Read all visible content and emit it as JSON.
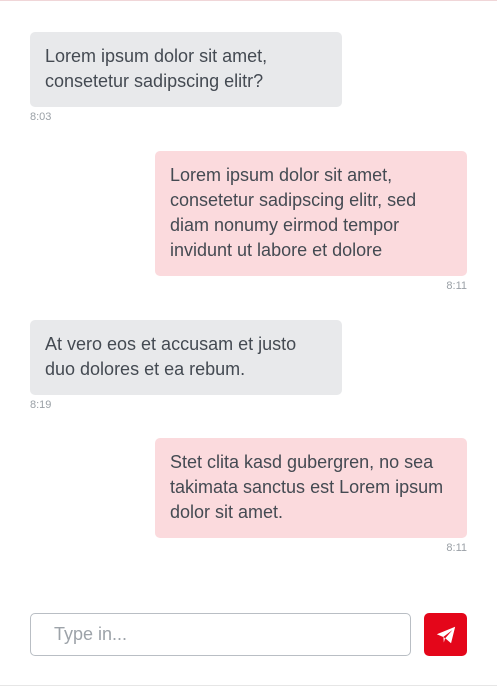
{
  "messages": [
    {
      "direction": "received",
      "text": "Lorem ipsum dolor sit amet, consetetur sadipscing elitr?",
      "time": "8:03"
    },
    {
      "direction": "sent",
      "text": "Lorem ipsum dolor sit amet, consetetur sadipscing elitr, sed diam nonumy eirmod tempor invidunt ut labore et dolore",
      "time": "8:11"
    },
    {
      "direction": "received",
      "text": "At vero eos et accusam et justo duo dolores et ea rebum.",
      "time": "8:19"
    },
    {
      "direction": "sent",
      "text": "Stet clita kasd gubergren, no sea takimata sanctus est Lorem ipsum dolor sit amet.",
      "time": "8:11"
    }
  ],
  "composer": {
    "placeholder": "Type in...",
    "value": "",
    "send_icon": "paper-plane-icon"
  },
  "colors": {
    "received_bubble": "#e8e9eb",
    "sent_bubble": "#fbdadd",
    "send_button": "#e4061a",
    "text": "#444a52"
  }
}
